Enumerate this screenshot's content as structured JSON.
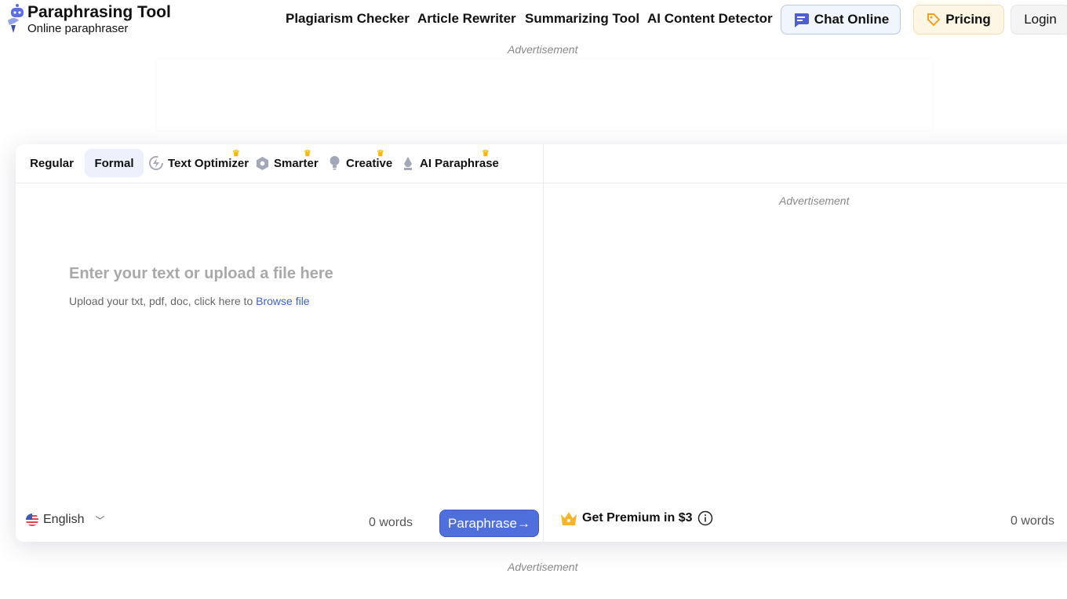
{
  "header": {
    "title": "Paraphrasing Tool",
    "subtitle": "Online paraphraser",
    "nav": [
      "Plagiarism Checker",
      "Article Rewriter",
      "Summarizing Tool",
      "AI Content Detector"
    ],
    "chat_label": "Chat Online",
    "pricing_label": "Pricing",
    "login_label": "Login"
  },
  "ads": {
    "top": "Advertisement",
    "right": "Advertisement",
    "bottom": "Advertisement"
  },
  "modes": [
    {
      "label": "Regular",
      "premium": false
    },
    {
      "label": "Formal",
      "premium": false,
      "active": true
    },
    {
      "label": "Text Optimizer",
      "premium": true,
      "icon": "lightning-icon"
    },
    {
      "label": "Smarter",
      "premium": true,
      "icon": "hexagon-icon"
    },
    {
      "label": "Creative",
      "premium": true,
      "icon": "bulb-icon"
    },
    {
      "label": "AI Paraphrase",
      "premium": true,
      "icon": "pen-icon"
    }
  ],
  "input": {
    "placeholder": "Enter your text or upload a file here",
    "upload_text": "Upload your txt, pdf, doc, click here to",
    "browse_link": "Browse file",
    "language": "English",
    "word_count": "0 words",
    "paraphrase_label": "Paraphrase"
  },
  "output": {
    "premium_label": "Get Premium in $3",
    "word_count": "0 words"
  },
  "colors": {
    "accent": "#4f6fdd",
    "crown": "#f5b800"
  }
}
